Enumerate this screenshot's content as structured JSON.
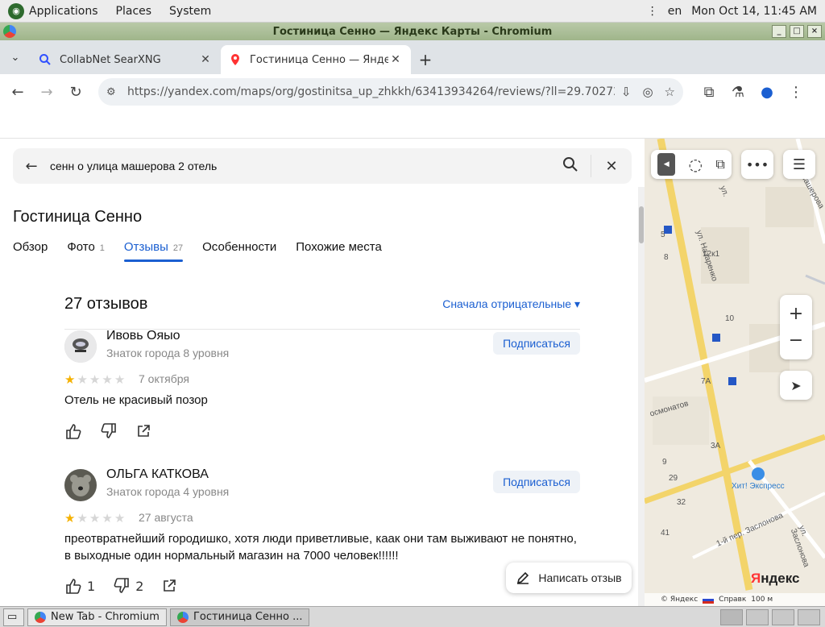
{
  "top_panel": {
    "applications": "Applications",
    "places": "Places",
    "system": "System",
    "lang": "en",
    "datetime": "Mon Oct 14, 11:45 AM"
  },
  "window": {
    "title": "Гостиница Сенно — Яндекс Карты - Chromium"
  },
  "tabs": [
    {
      "title": "CollabNet SearXNG",
      "active": false
    },
    {
      "title": "Гостиница Сенно — Яндекс",
      "active": true
    }
  ],
  "toolbar": {
    "url": "https://yandex.com/maps/org/gostinitsa_up_zhkkh/63413934264/reviews/?ll=29.702726%2..."
  },
  "search": {
    "query": "сенн о улица машерова 2 отель"
  },
  "org": {
    "name": "Гостиница Сенно"
  },
  "nav_tabs": [
    {
      "label": "Обзор",
      "count": ""
    },
    {
      "label": "Фото",
      "count": "1"
    },
    {
      "label": "Отзывы",
      "count": "27"
    },
    {
      "label": "Особенности",
      "count": ""
    },
    {
      "label": "Похожие места",
      "count": ""
    }
  ],
  "reviews_header": {
    "count": "27 отзывов",
    "sort": "Сначала отрицательные ▾"
  },
  "reviews": [
    {
      "name": "Ивовь Ояыо",
      "rank": "Знаток города 8 уровня",
      "subscribe": "Подписаться",
      "rating": 1,
      "date": "7 октября",
      "text": "Отель не красивый позор",
      "likes": "",
      "dislikes": ""
    },
    {
      "name": "ОЛЬГА КАТКОВА",
      "rank": "Знаток города 4 уровня",
      "subscribe": "Подписаться",
      "rating": 1,
      "date": "27 августа",
      "text": "преотвратнейший городишко, хотя люди приветливые, каак они там выживают не понятно, в выходные один нормальный магазин на 7000 человек!!!!!!",
      "likes": "1",
      "dislikes": "2"
    }
  ],
  "write_review": "Написать отзыв",
  "map": {
    "labels": {
      "street1": "ул. Назаренко",
      "street2": "осмонатов",
      "street3": "1-й пер. Заслонова",
      "street4": "ул. Заслонова",
      "street5": "машерова",
      "street6": "ул.",
      "poi": "Хит! Экспресс",
      "n1": "12к1",
      "n2": "10",
      "n3": "7А",
      "n4": "3А",
      "n5": "32",
      "n6": "41",
      "n7": "29",
      "n8": "9",
      "n9": "5",
      "n10": "8"
    },
    "logo_y": "Я",
    "logo_rest": "ндекс",
    "footer_copy": "© Яндекс",
    "footer_ref": "Справк",
    "footer_scale": "100 м"
  },
  "taskbar": {
    "items": [
      {
        "label": "New Tab - Chromium",
        "active": false
      },
      {
        "label": "Гостиница Сенно ...",
        "active": true
      }
    ]
  }
}
